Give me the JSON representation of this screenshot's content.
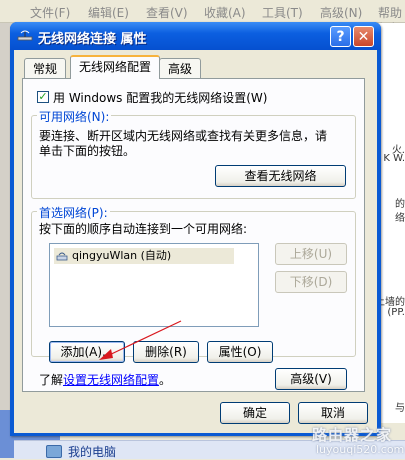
{
  "background": {
    "menu": [
      "文件(F)",
      "编辑(E)",
      "查看(V)",
      "收藏(A)",
      "工具(T)",
      "高级(N)",
      "帮助(H)"
    ],
    "right_fragments": [
      "火.",
      "K W.",
      "的",
      "络",
      "上墙的",
      "(PP.",
      "与"
    ],
    "taskbar_item": "我的电脑",
    "watermark": "路由器之家",
    "watermark_url": "luyouqi520.com"
  },
  "dialog": {
    "title": "无线网络连接 属性",
    "help_label": "?",
    "close_label": "✕",
    "tabs": [
      "常规",
      "无线网络配置",
      "高级"
    ],
    "use_windows_checkbox": {
      "label": "用 Windows 配置我的无线网络设置(W)",
      "checked": true
    },
    "available": {
      "group_label": "可用网络(N):",
      "description_line1": "要连接、断开区域内无线网络或查找有关更多信息，请",
      "description_line2": "单击下面的按钮。",
      "view_button": "查看无线网络"
    },
    "preferred": {
      "group_label": "首选网络(P):",
      "description": "按下面的顺序自动连接到一个可用网络:",
      "networks": [
        {
          "name": "qingyuWlan (自动)",
          "icon": "wireless-network-icon"
        }
      ],
      "move_up_button": "上移(U)",
      "move_down_button": "下移(D)",
      "add_button": "添加(A)...",
      "remove_button": "删除(R)",
      "properties_button": "属性(O)"
    },
    "learn_prefix": "了解",
    "learn_link": "设置无线网络配置",
    "learn_suffix": "。",
    "advanced_button": "高级(V)",
    "ok_button": "确定",
    "cancel_button": "取消"
  },
  "colors": {
    "title_bar": "#0c5fe0",
    "group_label": "#0046d5",
    "annotation_arrow": "#d9181e"
  }
}
